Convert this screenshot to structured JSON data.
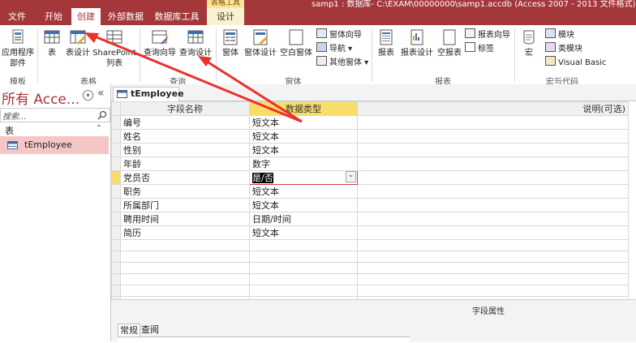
{
  "window": {
    "title": "samp1 : 数据库- C:\\EXAM\\00000000\\samp1.accdb (Access 2007 - 2013 文件格式)",
    "context_tools_label": "表格工具",
    "accent_color": "#a4373a"
  },
  "tabs": [
    {
      "label": "文件"
    },
    {
      "label": "开始"
    },
    {
      "label": "创建"
    },
    {
      "label": "外部数据"
    },
    {
      "label": "数据库工具"
    },
    {
      "label": "设计"
    }
  ],
  "ribbon": {
    "templates": {
      "label": "模板",
      "app_parts": "应用程序部件"
    },
    "tables": {
      "label": "表格",
      "table": "表",
      "table_design": "表设计",
      "sharepoint": "SharePoint列表"
    },
    "queries": {
      "label": "查询",
      "wizard": "查询向导",
      "design": "查询设计"
    },
    "forms": {
      "label": "窗体",
      "form": "窗体",
      "form_design": "窗体设计",
      "blank_form": "空白窗体",
      "form_wizard": "窗体向导",
      "navigation": "导航",
      "more_forms": "其他窗体"
    },
    "reports": {
      "label": "报表",
      "report": "报表",
      "report_design": "报表设计",
      "blank_report": "空报表",
      "report_wizard": "报表向导",
      "labels": "标签"
    },
    "macros": {
      "label": "宏与代码",
      "macro": "宏",
      "module": "模块",
      "class_module": "类模块",
      "visual_basic": "Visual Basic"
    }
  },
  "nav": {
    "title": "所有 Acce...",
    "search_placeholder": "搜索...",
    "section": "表",
    "item": "tEmployee"
  },
  "object_tab": {
    "label": "tEmployee"
  },
  "grid": {
    "headers": {
      "field_name": "字段名称",
      "data_type": "数据类型",
      "description": "说明(可选)"
    },
    "rows": [
      {
        "name": "编号",
        "type": "短文本"
      },
      {
        "name": "姓名",
        "type": "短文本"
      },
      {
        "name": "性别",
        "type": "短文本"
      },
      {
        "name": "年龄",
        "type": "数字"
      },
      {
        "name": "党员否",
        "type": "是/否"
      },
      {
        "name": "职务",
        "type": "短文本"
      },
      {
        "name": "所属部门",
        "type": "短文本"
      },
      {
        "name": "聘用时间",
        "type": "日期/时间"
      },
      {
        "name": "简历",
        "type": "短文本"
      }
    ]
  },
  "field_properties": {
    "title": "字段属性",
    "tabs": [
      {
        "label": "常规"
      },
      {
        "label": "查阅"
      }
    ]
  }
}
